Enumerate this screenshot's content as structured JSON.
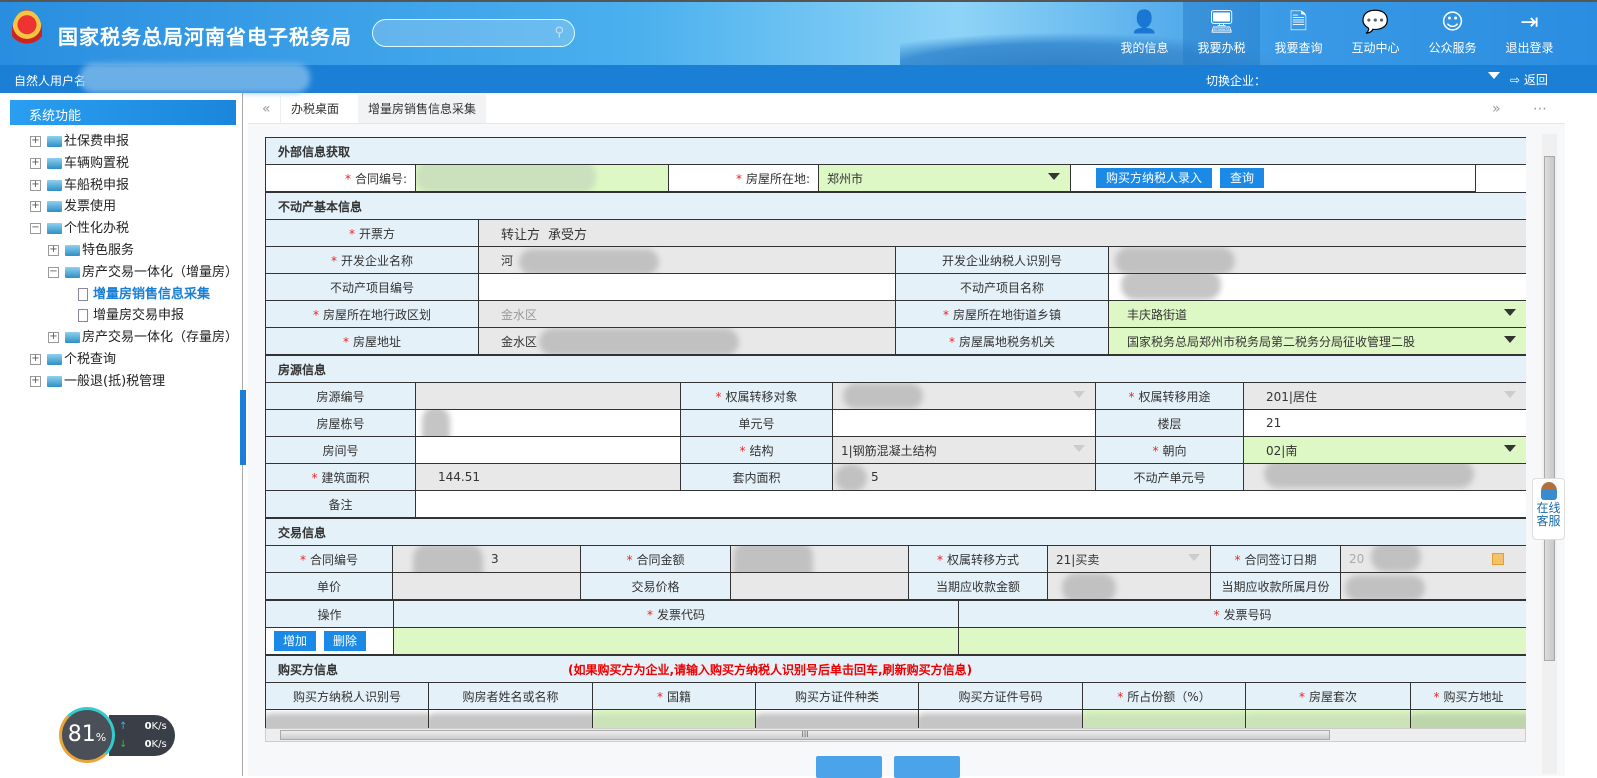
{
  "header": {
    "title": "国家税务总局河南省电子税务局",
    "nav": [
      {
        "label": "我的信息",
        "icon": "user-icon"
      },
      {
        "label": "我要办税",
        "icon": "monitor-icon"
      },
      {
        "label": "我要查询",
        "icon": "doc-search-icon"
      },
      {
        "label": "互动中心",
        "icon": "chat-icon"
      },
      {
        "label": "公众服务",
        "icon": "service-icon"
      },
      {
        "label": "退出登录",
        "icon": "logout-icon"
      }
    ]
  },
  "subbar": {
    "user_prefix": "自然人用户名",
    "switch_label": "切换企业：",
    "back": "返回"
  },
  "sidebar": {
    "title": "系统功能",
    "items": [
      "社保费申报",
      "车辆购置税",
      "车船税申报",
      "发票使用",
      "个性化办税",
      "特色服务",
      "房产交易一体化（增量房）",
      "增量房销售信息采集",
      "增量房交易申报",
      "房产交易一体化（存量房）",
      "个税查询",
      "一般退(抵)税管理"
    ]
  },
  "tabs": [
    "办税桌面",
    "增量房销售信息采集"
  ],
  "sysmon": {
    "cpu": "81",
    "unit": "%",
    "up": "0",
    "down": "0",
    "rate_unit": "K/s"
  },
  "form": {
    "ext": {
      "title": "外部信息获取",
      "contract_label": "合同编号:",
      "location_label": "房屋所在地:",
      "location_value": "郑州市",
      "btn_buyer": "购买方纳税人录入",
      "btn_query": "查询"
    },
    "estate": {
      "title": "不动产基本信息",
      "issuer_label": "开票方",
      "issuer_opts": [
        "转让方",
        "承受方"
      ],
      "dev_name_label": "开发企业名称",
      "dev_name_value": "河",
      "dev_tin_label": "开发企业纳税人识别号",
      "proj_no_label": "不动产项目编号",
      "proj_name_label": "不动产项目名称",
      "district_label": "房屋所在地行政区划",
      "district_value": "金水区",
      "street_label": "房屋所在地街道乡镇",
      "street_value": "丰庆路街道",
      "address_label": "房屋地址",
      "address_value": "金水区",
      "tax_office_label": "房屋属地税务机关",
      "tax_office_value": "国家税务总局郑州市税务局第二税务分局征收管理二股"
    },
    "house": {
      "title": "房源信息",
      "src_no": "房源编号",
      "transfer_obj": "权属转移对象",
      "transfer_use": "权属转移用途",
      "transfer_use_value": "201|居住",
      "building_no": "房屋栋号",
      "unit_no": "单元号",
      "floor": "楼层",
      "floor_value": "21",
      "room_no": "房间号",
      "structure": "结构",
      "structure_value": "1|钢筋混凝土结构",
      "orientation": "朝向",
      "orientation_value": "02|南",
      "area": "建筑面积",
      "area_value": "144.51",
      "inner_area": "套内面积",
      "inner_area_value": "5",
      "unit_code": "不动产单元号",
      "remark": "备注"
    },
    "trade": {
      "title": "交易信息",
      "contract_no": "合同编号",
      "contract_no_value": "3",
      "contract_amt": "合同金额",
      "transfer_way": "权属转移方式",
      "transfer_way_value": "21|买卖",
      "sign_date": "合同签订日期",
      "sign_date_value": "20",
      "unit_price": "单价",
      "trade_price": "交易价格",
      "due_amt": "当期应收款金额",
      "due_month": "当期应收款所属月份",
      "op": "操作",
      "inv_code": "发票代码",
      "inv_no": "发票号码",
      "add": "增加",
      "del": "删除"
    },
    "buyer": {
      "title": "购买方信息",
      "note": "(如果购买方为企业,请输入购买方纳税人识别号后单击回车,刷新购买方信息)",
      "cols": [
        "购买方纳税人识别号",
        "购房者姓名或名称",
        "国籍",
        "购买方证件种类",
        "购买方证件号码",
        "所占份额（%）",
        "房屋套次",
        "购买方地址"
      ]
    }
  },
  "kefu": {
    "line1": "在线",
    "line2": "客服"
  }
}
